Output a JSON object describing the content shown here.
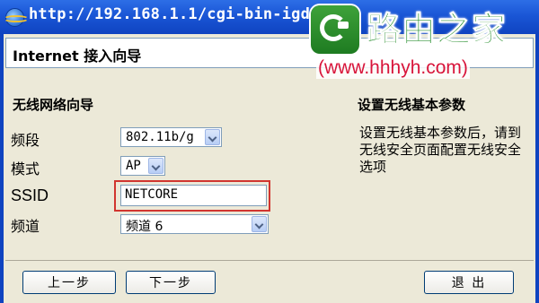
{
  "window": {
    "title": "http://192.168.1.1/cgi-bin-igd/",
    "header": "Internet 接入向导"
  },
  "watermark": {
    "brand": "路由之家",
    "url": "(www.hhhyh.com)"
  },
  "wizard": {
    "section_title": "无线网络向导",
    "fields": {
      "band": {
        "label": "频段",
        "value": "802.11b/g"
      },
      "mode": {
        "label": "模式",
        "value": "AP"
      },
      "ssid": {
        "label": "SSID",
        "value": "NETCORE"
      },
      "channel": {
        "label": "频道",
        "value": "频道 6"
      }
    }
  },
  "help": {
    "title": "设置无线基本参数",
    "text": "设置无线基本参数后，请到无线安全页面配置无线安全选项"
  },
  "buttons": {
    "prev": "上一步",
    "next": "下一步",
    "exit": "退 出"
  },
  "colors": {
    "titlebar": "#1a56d6",
    "highlight": "#d1352f",
    "watermark_green": "#1d8a24",
    "watermark_url": "#d8143a"
  }
}
